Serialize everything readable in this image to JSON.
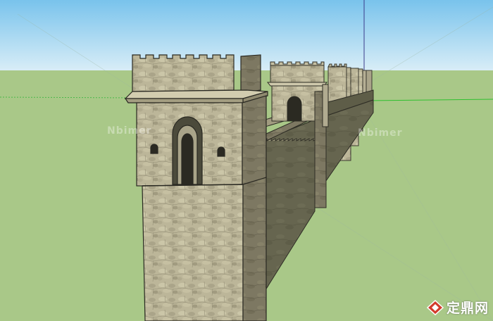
{
  "colors": {
    "sky_top": "#7ac3ec",
    "sky_bottom": "#d6ecf6",
    "ground": "#a9c888",
    "stone": "#bdb79b",
    "stone_dark": "#76715c",
    "wall_shadow": "#62614c",
    "axis_green": "#2fc02f",
    "axis_blue": "#4a4aa0",
    "logo_red": "#d23b2b"
  },
  "watermark": {
    "left_text": "Nbimer",
    "right_text": "Nbimer"
  },
  "logo": {
    "icon": "diamond-logo-icon",
    "text": "定鼎网"
  }
}
